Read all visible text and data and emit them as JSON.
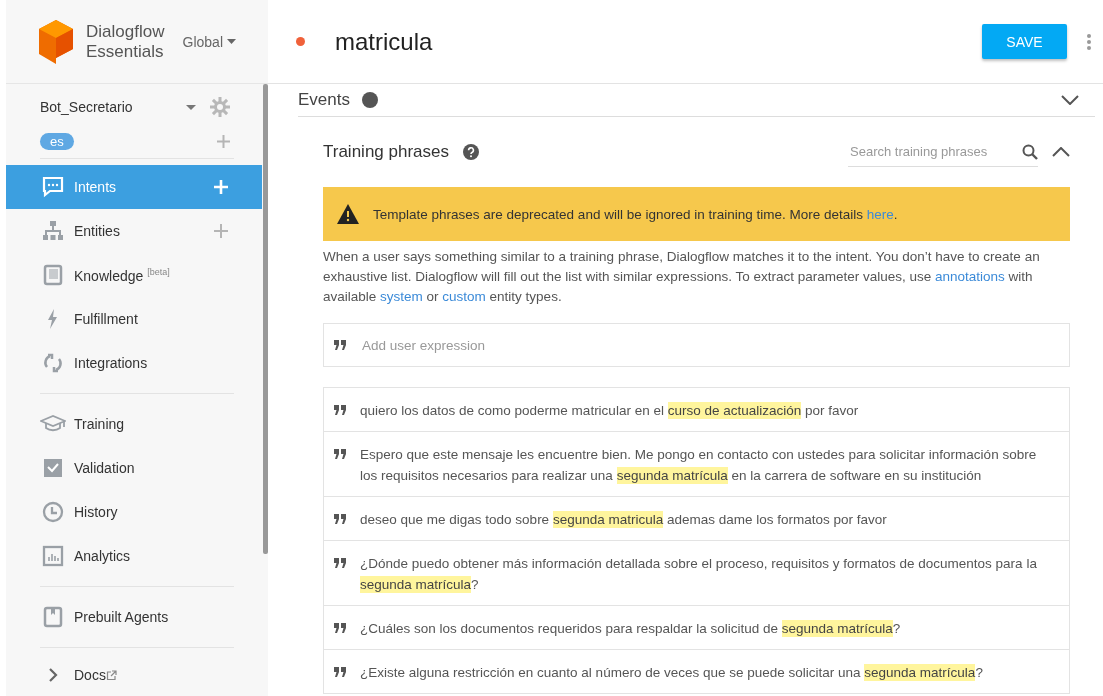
{
  "brand": {
    "name_line1": "Dialogflow",
    "name_line2": "Essentials",
    "region": "Global"
  },
  "agent": {
    "name": "Bot_Secretario",
    "language": "es"
  },
  "sidebar": {
    "groups": [
      [
        {
          "label": "Intents",
          "selected": true,
          "add": true
        },
        {
          "label": "Entities",
          "selected": false,
          "add": true
        },
        {
          "label": "Knowledge $^{[beta]}$",
          "selected": false,
          "add": false
        },
        {
          "label": "Fulfillment",
          "selected": false,
          "add": false
        },
        {
          "label": "Integrations",
          "selected": false,
          "add": false
        }
      ],
      [
        {
          "label": "Training",
          "selected": false,
          "add": false
        },
        {
          "label": "Validation",
          "selected": false,
          "add": false
        },
        {
          "label": "History",
          "selected": false,
          "add": false
        },
        {
          "label": "Analytics",
          "selected": false,
          "add": false
        }
      ],
      [
        {
          "label": "Prebuilt Agents",
          "selected": false,
          "add": false
        }
      ],
      [
        {
          "label": "Docs",
          "selected": false,
          "add": false,
          "kind": "external"
        }
      ]
    ]
  },
  "header": {
    "intent_name": "matricula",
    "unsaved": true,
    "save_label": "SAVE"
  },
  "sections": {
    "events_title": "Events",
    "training_title": "Training phrases",
    "search_placeholder": "Search training phrases",
    "warning": "Template phrases are deprecated and will be ignored in training time. More details",
    "warning_link": "here",
    "warning_end": ".",
    "help": [
      {
        "text": "When a user says something similar to a training phrase, Dialogflow matches it to the intent. You don’t have to create an exhaustive list. Dialogflow will fill out the list with similar expressions. To extract parameter values, use ",
        "link": false
      },
      {
        "text": "annotations",
        "link": true
      },
      {
        "text": " with available ",
        "link": false
      },
      {
        "text": "system",
        "link": true
      },
      {
        "text": " or ",
        "link": false
      },
      {
        "text": "custom",
        "link": true
      },
      {
        "text": " entity types.",
        "link": false
      }
    ],
    "add_placeholder": "Add user expression"
  },
  "phrases": [
    [
      {
        "text": "quiero los datos de como poderme matricular en el ",
        "annotated": false
      },
      {
        "text": "curso de actualización",
        "annotated": true
      },
      {
        "text": " por favor",
        "annotated": false
      }
    ],
    [
      {
        "text": "Espero que este mensaje les encuentre bien. Me pongo en contacto con ustedes para solicitar información sobre los requisitos necesarios para realizar una ",
        "annotated": false
      },
      {
        "text": "segunda matrícula",
        "annotated": true
      },
      {
        "text": " en la carrera de software en su institución",
        "annotated": false
      }
    ],
    [
      {
        "text": "deseo que me digas todo sobre ",
        "annotated": false
      },
      {
        "text": "segunda matricula",
        "annotated": true
      },
      {
        "text": " ademas dame los formatos por favor",
        "annotated": false
      }
    ],
    [
      {
        "text": "¿Dónde puedo obtener más información detallada sobre el proceso, requisitos y formatos de documentos para la ",
        "annotated": false
      },
      {
        "text": "segunda matrícula",
        "annotated": true
      },
      {
        "text": "?",
        "annotated": false
      }
    ],
    [
      {
        "text": "¿Cuáles son los documentos requeridos para respaldar la solicitud de ",
        "annotated": false
      },
      {
        "text": "segunda matrícula",
        "annotated": true
      },
      {
        "text": "?",
        "annotated": false
      }
    ],
    [
      {
        "text": "¿Existe alguna restricción en cuanto al número de veces que se puede solicitar una ",
        "annotated": false
      },
      {
        "text": "segunda matrícula",
        "annotated": true
      },
      {
        "text": "?",
        "annotated": false
      }
    ]
  ]
}
